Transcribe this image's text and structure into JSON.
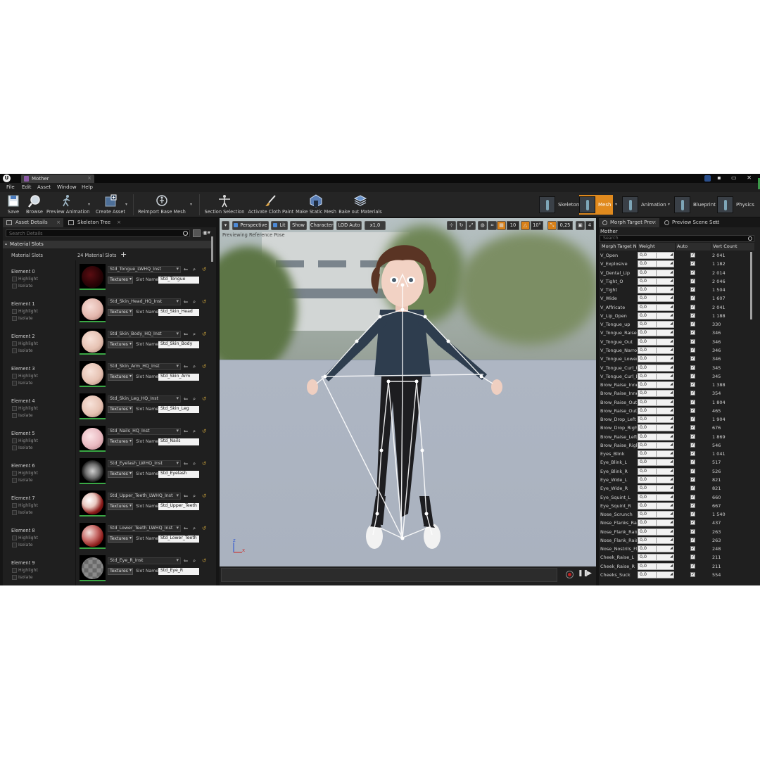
{
  "title_bar": {
    "tab_label": "Mother",
    "close": "×",
    "window_controls": "▪ ▭ ✕"
  },
  "menu": [
    "File",
    "Edit",
    "Asset",
    "Window",
    "Help"
  ],
  "toolbar": {
    "save": "Save",
    "browse": "Browse",
    "preview_animation": "Preview Animation",
    "create_asset": "Create Asset",
    "reimport_base_mesh": "Reimport Base Mesh",
    "section_selection": "Section Selection",
    "activate_cloth_paint": "Activate Cloth Paint",
    "make_static_mesh": "Make Static Mesh",
    "bake_out_materials": "Bake out Materials",
    "modes": {
      "skeleton": "Skeleton",
      "mesh": "Mesh",
      "animation": "Animation",
      "blueprint": "Blueprint",
      "physics": "Physics"
    },
    "active_mode": "Mesh",
    "active_color": "#e08a1e"
  },
  "left_panel": {
    "tabs": [
      "Asset Details",
      "Skeleton Tree"
    ],
    "tab_close": "×",
    "search_placeholder": "Search Details",
    "section_title": "Material Slots",
    "slots_label": "Material Slots",
    "slots_count": "24 Material Slots",
    "add_symbol": "+",
    "highlight_label": "Highlight",
    "isolate_label": "Isolate",
    "textures_label": "Textures",
    "slot_name_label": "Slot Name",
    "elements": [
      {
        "name": "Element 0",
        "material": "Std_Tongue_LWHQ_Inst",
        "slot": "Std_Tongue",
        "sphere": "radial-gradient(circle at 40% 40%, #5a0d12 0%, #2a0306 55%, #0a0000 100%)"
      },
      {
        "name": "Element 1",
        "material": "Std_Skin_Head_HQ_Inst",
        "slot": "Std_Skin_Head",
        "sphere": "radial-gradient(circle at 40% 38%, #f6dcd6 0%, #e3b7ad 55%, #9e7068 100%)"
      },
      {
        "name": "Element 2",
        "material": "Std_Skin_Body_HQ_Inst",
        "slot": "Std_Skin_Body",
        "sphere": "radial-gradient(circle at 40% 38%, #f7e2d9 0%, #e6c2b3 55%, #a47d70 100%)"
      },
      {
        "name": "Element 3",
        "material": "Std_Skin_Arm_HQ_Inst",
        "slot": "Std_Skin_Arm",
        "sphere": "radial-gradient(circle at 40% 38%, #f7e2d9 0%, #e6c2b3 55%, #a47d70 100%)"
      },
      {
        "name": "Element 4",
        "material": "Std_Skin_Leg_HQ_Inst",
        "slot": "Std_Skin_Leg",
        "sphere": "radial-gradient(circle at 40% 38%, #f7e2d9 0%, #e6c2b3 55%, #a47d70 100%)"
      },
      {
        "name": "Element 5",
        "material": "Std_Nails_HQ_Inst",
        "slot": "Std_Nails",
        "sphere": "radial-gradient(circle at 40% 38%, #fbe3e6 0%, #e9b9c0 55%, #a9777e 100%)"
      },
      {
        "name": "Element 6",
        "material": "Std_Eyelash_LWHQ_Inst",
        "slot": "Std_Eyelash",
        "sphere": "radial-gradient(circle at 50% 50%, #cfcfcf 0%, #6e6e6e 45%, #1b1b1b 70%, #0a0a0a 100%)"
      },
      {
        "name": "Element 7",
        "material": "Std_Upper_Teeth_LWHQ_Inst",
        "slot": "Std_Upper_Teeth",
        "sphere": "radial-gradient(circle at 35% 35%, #ffffff 0%, #e9c8c0 35%, #8a1a18 65%, #2b0404 100%)"
      },
      {
        "name": "Element 8",
        "material": "Std_Lower_Teeth_LWHQ_Inst",
        "slot": "Std_Lower_Teeth",
        "sphere": "radial-gradient(circle at 35% 35%, #f3e0dc 0%, #c86d6a 40%, #8a1a18 70%, #2b0404 100%)"
      },
      {
        "name": "Element 9",
        "material": "Std_Eye_R_Inst",
        "slot": "Std_Eye_R",
        "sphere": "repeating-conic-gradient(#8a8a8a 0% 25%, #6a6a6a 0% 50%) 50% / 12px 12px"
      }
    ]
  },
  "viewport": {
    "perspective": "Perspective",
    "lit": "Lit",
    "show": "Show",
    "character": "Character",
    "lod": "LOD Auto",
    "speed": "x1,0",
    "grid_snap": "10",
    "rot_snap": "10°",
    "scale_snap": "0,25",
    "camera_speed": "4",
    "preview_note": "Previewing Reference Pose",
    "axis_x": "x",
    "axis_z": "z"
  },
  "right_panel": {
    "tabs": [
      "Morph Target Prev",
      "Preview Scene Sett"
    ],
    "tab_close": "×",
    "asset_name": "Mother",
    "search_placeholder": "Search",
    "columns": [
      "Morph Target N",
      "Weight",
      "Auto",
      "Vert Count"
    ],
    "morphs": [
      {
        "name": "V_Open",
        "weight": "0,0",
        "verts": "2 041"
      },
      {
        "name": "V_Explosive",
        "weight": "0,0",
        "verts": "1 182"
      },
      {
        "name": "V_Dental_Lip",
        "weight": "0,0",
        "verts": "2 014"
      },
      {
        "name": "V_Tight_O",
        "weight": "0,0",
        "verts": "2 046"
      },
      {
        "name": "V_Tight",
        "weight": "0,0",
        "verts": "1 504"
      },
      {
        "name": "V_Wide",
        "weight": "0,0",
        "verts": "1 607"
      },
      {
        "name": "V_Affricate",
        "weight": "0,0",
        "verts": "2 041"
      },
      {
        "name": "V_Lip_Open",
        "weight": "0,0",
        "verts": "1 188"
      },
      {
        "name": "V_Tongue_up",
        "weight": "0,0",
        "verts": "330"
      },
      {
        "name": "V_Tongue_Raise",
        "weight": "0,0",
        "verts": "346"
      },
      {
        "name": "V_Tongue_Out",
        "weight": "0,0",
        "verts": "346"
      },
      {
        "name": "V_Tongue_Narrow",
        "weight": "0,0",
        "verts": "346"
      },
      {
        "name": "V_Tongue_Lower",
        "weight": "0,0",
        "verts": "346"
      },
      {
        "name": "V_Tongue_Curl_U",
        "weight": "0,0",
        "verts": "345"
      },
      {
        "name": "V_Tongue_Curl_D",
        "weight": "0,0",
        "verts": "345"
      },
      {
        "name": "Brow_Raise_Inner",
        "weight": "0,0",
        "verts": "1 388"
      },
      {
        "name": "Brow_Raise_Inner",
        "weight": "0,0",
        "verts": "354"
      },
      {
        "name": "Brow_Raise_Outer",
        "weight": "0,0",
        "verts": "1 804"
      },
      {
        "name": "Brow_Raise_Outer",
        "weight": "0,0",
        "verts": "465"
      },
      {
        "name": "Brow_Drop_Left",
        "weight": "0,0",
        "verts": "1 904"
      },
      {
        "name": "Brow_Drop_Right",
        "weight": "0,0",
        "verts": "676"
      },
      {
        "name": "Brow_Raise_Left",
        "weight": "0,0",
        "verts": "1 869"
      },
      {
        "name": "Brow_Raise_Right",
        "weight": "0,0",
        "verts": "546"
      },
      {
        "name": "Eyes_Blink",
        "weight": "0,0",
        "verts": "1 041"
      },
      {
        "name": "Eye_Blink_L",
        "weight": "0,0",
        "verts": "517"
      },
      {
        "name": "Eye_Blink_R",
        "weight": "0,0",
        "verts": "526"
      },
      {
        "name": "Eye_Wide_L",
        "weight": "0,0",
        "verts": "821"
      },
      {
        "name": "Eye_Wide_R",
        "weight": "0,0",
        "verts": "821"
      },
      {
        "name": "Eye_Squint_L",
        "weight": "0,0",
        "verts": "660"
      },
      {
        "name": "Eye_Squint_R",
        "weight": "0,0",
        "verts": "667"
      },
      {
        "name": "Nose_Scrunch",
        "weight": "0,0",
        "verts": "1 540"
      },
      {
        "name": "Nose_Flanks_Raise",
        "weight": "0,0",
        "verts": "437"
      },
      {
        "name": "Nose_Flank_Raise",
        "weight": "0,0",
        "verts": "263"
      },
      {
        "name": "Nose_Flank_Raise",
        "weight": "0,0",
        "verts": "263"
      },
      {
        "name": "Nose_Nostrils_Fla",
        "weight": "0,0",
        "verts": "248"
      },
      {
        "name": "Cheek_Raise_L",
        "weight": "0,0",
        "verts": "211"
      },
      {
        "name": "Cheek_Raise_R",
        "weight": "0,0",
        "verts": "211"
      },
      {
        "name": "Cheeks_Suck",
        "weight": "0,0",
        "verts": "554"
      }
    ]
  }
}
